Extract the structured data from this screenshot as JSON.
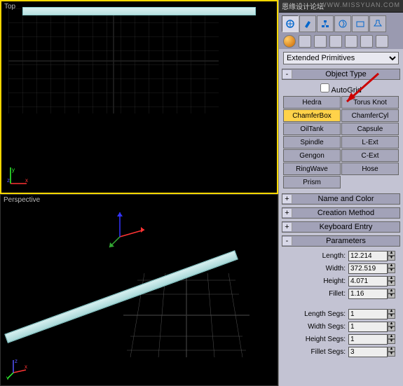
{
  "titlebar": "恩缘设计论坛",
  "watermark": "WWW.MISSYUAN.COM",
  "viewports": {
    "top_label": "Top",
    "persp_label": "Perspective"
  },
  "gizmo": {
    "x": "x",
    "y": "y",
    "z": "z"
  },
  "dropdown": {
    "selected": "Extended Primitives"
  },
  "rollouts": {
    "object_type": {
      "title": "Object Type",
      "toggle": "-"
    },
    "name_color": {
      "title": "Name and Color",
      "toggle": "+"
    },
    "creation_method": {
      "title": "Creation Method",
      "toggle": "+"
    },
    "keyboard_entry": {
      "title": "Keyboard Entry",
      "toggle": "+"
    },
    "parameters": {
      "title": "Parameters",
      "toggle": "-"
    }
  },
  "autogrid": "AutoGrid",
  "object_buttons": [
    "Hedra",
    "Torus Knot",
    "ChamferBox",
    "ChamferCyl",
    "OilTank",
    "Capsule",
    "Spindle",
    "L-Ext",
    "Gengon",
    "C-Ext",
    "RingWave",
    "Hose",
    "Prism",
    ""
  ],
  "selected_button": "ChamferBox",
  "params": {
    "length": {
      "label": "Length:",
      "value": "12.214"
    },
    "width": {
      "label": "Width:",
      "value": "372.519"
    },
    "height": {
      "label": "Height:",
      "value": "4.071"
    },
    "fillet": {
      "label": "Fillet:",
      "value": "1.16"
    },
    "length_segs": {
      "label": "Length Segs:",
      "value": "1"
    },
    "width_segs": {
      "label": "Width Segs:",
      "value": "1"
    },
    "height_segs": {
      "label": "Height Segs:",
      "value": "1"
    },
    "fillet_segs": {
      "label": "Fillet Segs:",
      "value": "3"
    }
  }
}
